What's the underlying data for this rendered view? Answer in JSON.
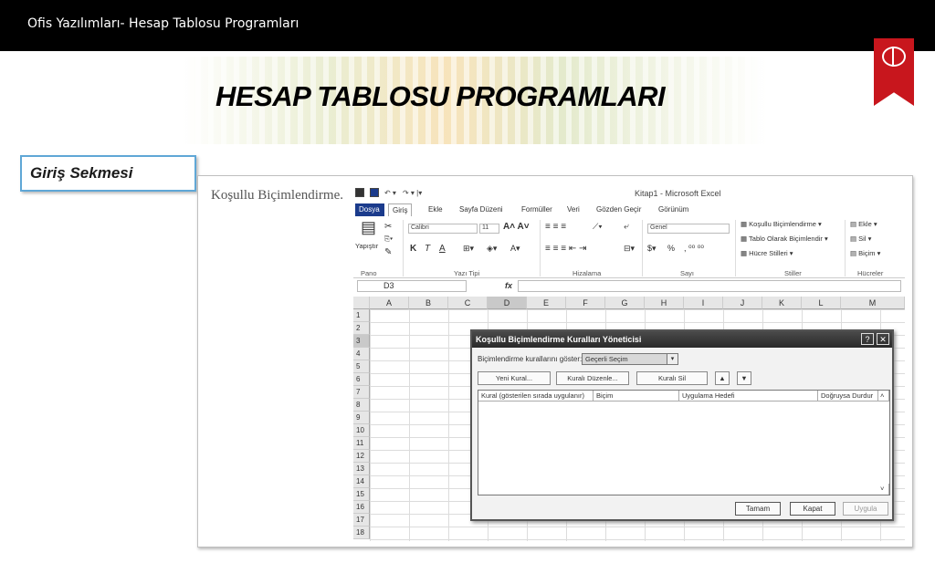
{
  "slide": {
    "header_title": "Ofis Yazılımları- Hesap Tablosu Programları",
    "page_title": "HESAP TABLOSU PROGRAMLARI",
    "section_label": "Giriş Sekmesi",
    "caption": "Koşullu Biçimlendirme.",
    "badge_color": "#c8161d"
  },
  "excel": {
    "window_title": "Kitap1 - Microsoft Excel",
    "tabs": [
      "Dosya",
      "Giriş",
      "Ekle",
      "Sayfa Düzeni",
      "Formüller",
      "Veri",
      "Gözden Geçir",
      "Görünüm"
    ],
    "active_tab": "Giriş",
    "ribbon": {
      "paste_label": "Yapıştır",
      "font_name": "Calibri",
      "font_size": "11",
      "number_format": "Genel",
      "bold": "K",
      "italic": "T",
      "underline": "A",
      "percent": "%",
      "conditional_formatting": "Koşullu Biçimlendirme",
      "format_as_table": "Tablo Olarak Biçimlendir",
      "cell_styles": "Hücre Stilleri",
      "insert": "Ekle",
      "delete": "Sil",
      "format": "Biçim",
      "groups": [
        "Pano",
        "Yazı Tipi",
        "Hizalama",
        "Sayı",
        "Stiller",
        "Hücreler"
      ]
    },
    "name_box": "D3",
    "fx": "fx",
    "columns": [
      "A",
      "B",
      "C",
      "D",
      "E",
      "F",
      "G",
      "H",
      "I",
      "J",
      "K",
      "L",
      "M"
    ],
    "selected_column": "D",
    "rows": [
      "1",
      "2",
      "3",
      "4",
      "5",
      "6",
      "7",
      "8",
      "9",
      "10",
      "11",
      "12",
      "13",
      "14",
      "15",
      "16",
      "17",
      "18"
    ],
    "selected_row": "3"
  },
  "dialog": {
    "title": "Koşullu Biçimlendirme Kuralları Yöneticisi",
    "help": "?",
    "close": "✕",
    "show_rules_label": "Biçimlendirme kurallarını göster:",
    "show_rules_value": "Geçerli Seçim",
    "new_rule": "Yeni Kural...",
    "edit_rule": "Kuralı Düzenle...",
    "delete_rule": "Kuralı Sil",
    "move_up": "▲",
    "move_down": "▼",
    "col_rule": "Kural (gösterilen sırada uygulanır)",
    "col_format": "Biçim",
    "col_applies": "Uygulama Hedefi",
    "col_stop": "Doğruysa Durdur",
    "ok": "Tamam",
    "close_button": "Kapat",
    "apply": "Uygula"
  }
}
